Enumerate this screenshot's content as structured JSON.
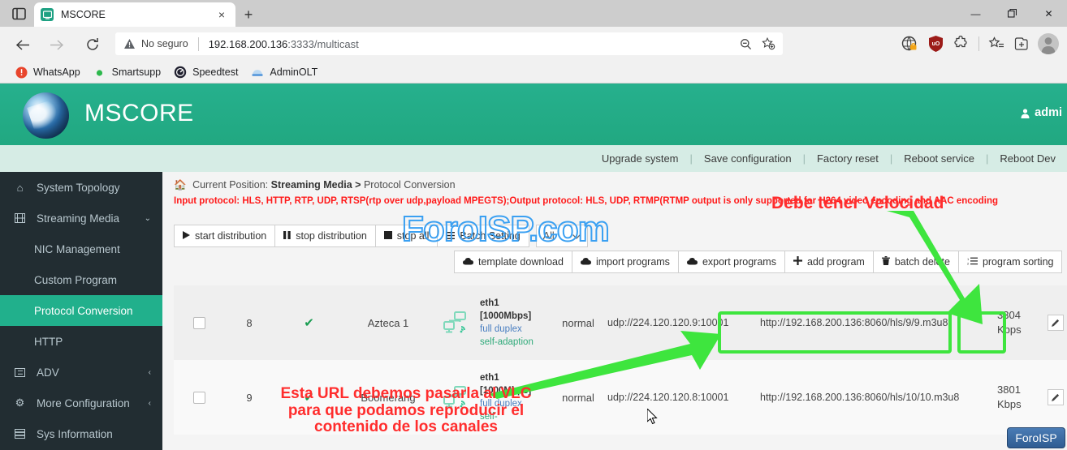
{
  "browser": {
    "tab_title": "MSCORE",
    "tab_close": "×",
    "new_tab": "+",
    "nav": {
      "back": "←",
      "forward": "→",
      "reload": "↻"
    },
    "omnibox": {
      "security_label": "No seguro",
      "url_host": "192.168.200.136",
      "url_rest": ":3333/multicast",
      "zoom_icon": "zoom-out-icon",
      "favorite_icon": "add-favorite-icon"
    },
    "bookmarks": [
      {
        "label": "WhatsApp",
        "icon": "whatsapp-icon",
        "color": "#e8452c"
      },
      {
        "label": "Smartsupp",
        "icon": "smartsupp-icon",
        "color": "#2db84c"
      },
      {
        "label": "Speedtest",
        "icon": "speedtest-icon",
        "color": "#1f1f2e"
      },
      {
        "label": "AdminOLT",
        "icon": "adminolt-icon",
        "color": "#4a90d9"
      }
    ],
    "window_controls": {
      "minimize": "—",
      "maximize": "❐",
      "close": "✕"
    }
  },
  "app": {
    "brand": "MSCORE",
    "user": "admi",
    "accent_color": "#21b08c",
    "action_links": [
      "Upgrade system",
      "Save configuration",
      "Factory reset",
      "Reboot service",
      "Reboot Dev"
    ],
    "action_separator": "|"
  },
  "sidebar": {
    "items": [
      {
        "label": "System Topology",
        "icon": "home-icon",
        "indent": false,
        "active": false,
        "caret": ""
      },
      {
        "label": "Streaming Media",
        "icon": "film-icon",
        "indent": false,
        "active": false,
        "caret": "⌄"
      },
      {
        "label": "NIC Management",
        "icon": "",
        "indent": true,
        "active": false,
        "caret": ""
      },
      {
        "label": "Custom Program",
        "icon": "",
        "indent": true,
        "active": false,
        "caret": ""
      },
      {
        "label": "Protocol Conversion",
        "icon": "",
        "indent": true,
        "active": true,
        "caret": ""
      },
      {
        "label": "HTTP",
        "icon": "",
        "indent": true,
        "active": false,
        "caret": ""
      },
      {
        "label": "ADV",
        "icon": "list-icon",
        "indent": false,
        "active": false,
        "caret": "‹"
      },
      {
        "label": "More Configuration",
        "icon": "gears-icon",
        "indent": false,
        "active": false,
        "caret": "‹"
      },
      {
        "label": "Sys Information",
        "icon": "server-icon",
        "indent": false,
        "active": false,
        "caret": ""
      }
    ]
  },
  "content": {
    "breadcrumb_prefix": "Current Position:",
    "breadcrumb_parent": "Streaming Media",
    "breadcrumb_sep": ">",
    "breadcrumb_current": "Protocol Conversion",
    "notice": "Input protocol: HLS, HTTP, RTP, UDP,  RTSP(rtp over udp,payload MPEGTS);Output protocol: HLS, UDP, RTMP(RTMP output is only supported for H264 video encoding and AAC encoding",
    "toolbar_primary": [
      {
        "label": "start distribution",
        "icon": "play-icon"
      },
      {
        "label": "stop distribution",
        "icon": "pause-icon"
      },
      {
        "label": "stop all",
        "icon": "stop-icon"
      },
      {
        "label": "Batch Setting",
        "icon": "bars-icon"
      }
    ],
    "filter_select": {
      "value": "All",
      "caret": "⌄"
    },
    "toolbar_secondary": [
      {
        "label": "template download",
        "icon": "cloud-download-icon"
      },
      {
        "label": "import programs",
        "icon": "cloud-upload-icon"
      },
      {
        "label": "export programs",
        "icon": "cloud-export-icon"
      },
      {
        "label": "add program",
        "icon": "plus-icon"
      },
      {
        "label": "batch delete",
        "icon": "trash-icon"
      },
      {
        "label": "program sorting",
        "icon": "sort-icon"
      }
    ],
    "rows": [
      {
        "num": "8",
        "status_icon": "check-icon",
        "name": "Azteca 1",
        "nic_icon": "network-icon",
        "eth_name": "eth1",
        "eth_speed": "[1000Mbps]",
        "eth_duplex": "full duplex",
        "eth_adaption": "self-adaption",
        "state": "normal",
        "input_url": "udp://224.120.120.9:10001",
        "output_url": "http://192.168.200.136:8060/hls/9/9.m3u8",
        "bitrate": "3304",
        "bitrate_unit": "Kbps",
        "edit_icon": "pencil-icon",
        "delete_icon": "close-icon"
      },
      {
        "num": "9",
        "status_icon": "check-icon",
        "name": "Boomerang",
        "nic_icon": "network-icon",
        "eth_name": "eth1",
        "eth_speed": "[1000Mbps]",
        "eth_duplex": "full duplex",
        "eth_adaption": "self-",
        "state": "normal",
        "input_url": "udp://224.120.120.8:10001",
        "output_url": "http://192.168.200.136:8060/hls/10/10.m3u8",
        "bitrate": "3801",
        "bitrate_unit": "Kbps",
        "edit_icon": "pencil-icon",
        "delete_icon": "close-icon"
      }
    ]
  },
  "annotations": {
    "watermark": "ForoISP.com",
    "watermark_color": "#3aa0f2",
    "callout_speed": "Debe tener Velocidad",
    "callout_url_line1": "Esta URL debemos pasarla al VLC",
    "callout_url_line2": "para que podamos reproducir el",
    "callout_url_line3": "contenido de los canales",
    "callout_color": "#ff2d2d",
    "highlight_color": "#3ee53e",
    "badge": "ForoISP"
  }
}
